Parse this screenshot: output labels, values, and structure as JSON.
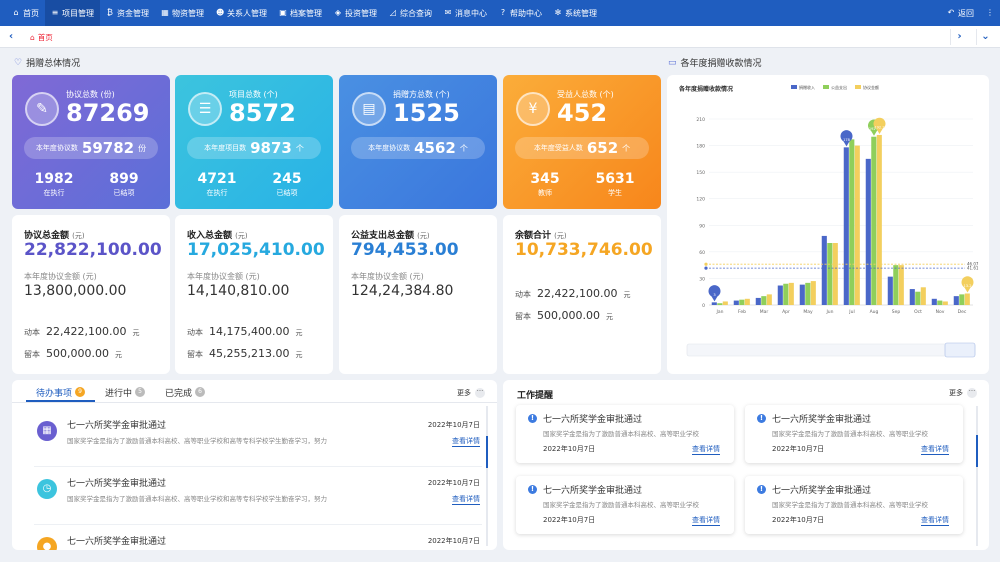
{
  "nav": {
    "items": [
      {
        "label": "首页",
        "icon": "home-icon",
        "glyph": "⌂"
      },
      {
        "label": "项目管理",
        "icon": "list-icon",
        "glyph": "≡",
        "active": true
      },
      {
        "label": "资金管理",
        "icon": "money-icon",
        "glyph": "₿"
      },
      {
        "label": "物资管理",
        "icon": "box-icon",
        "glyph": "▦"
      },
      {
        "label": "关系人管理",
        "icon": "people-icon",
        "glyph": "☻"
      },
      {
        "label": "档案管理",
        "icon": "folder-icon",
        "glyph": "▣"
      },
      {
        "label": "投资管理",
        "icon": "tag-icon",
        "glyph": "◈"
      },
      {
        "label": "综合查询",
        "icon": "chart-icon",
        "glyph": "◿"
      },
      {
        "label": "消息中心",
        "icon": "mail-icon",
        "glyph": "✉"
      },
      {
        "label": "帮助中心",
        "icon": "help-icon",
        "glyph": "?"
      },
      {
        "label": "系统管理",
        "icon": "gear-icon",
        "glyph": "✻"
      }
    ],
    "back_label": "返回"
  },
  "tabbar": {
    "home_tab": "首页"
  },
  "sections": {
    "donation_overview": "捐赠总体情况",
    "yearly_chart": "各年度捐赠收款情况"
  },
  "kpis": [
    {
      "label": "协议总数 (份)",
      "value": "87269",
      "pill_label": "本年度协议数",
      "pill_value": "59782",
      "pill_unit": "份",
      "sub1_value": "1982",
      "sub1_label": "在执行",
      "sub2_value": "899",
      "sub2_label": "已结项",
      "icon": "contract-icon",
      "glyph": "✎",
      "gradient": [
        "#8069d6",
        "#5b6fd8"
      ]
    },
    {
      "label": "项目总数 (个)",
      "value": "8572",
      "pill_label": "本年度项目数",
      "pill_value": "9873",
      "pill_unit": "个",
      "sub1_value": "4721",
      "sub1_label": "在执行",
      "sub2_value": "245",
      "sub2_label": "已结项",
      "icon": "clipboard-icon",
      "glyph": "☰",
      "gradient": [
        "#3cc4de",
        "#28b2e6"
      ]
    },
    {
      "label": "捐赠方总数 (个)",
      "value": "1525",
      "pill_label": "本年度协议数",
      "pill_value": "4562",
      "pill_unit": "个",
      "sub1_value": "",
      "sub1_label": "",
      "sub2_value": "",
      "sub2_label": "",
      "icon": "contact-card-icon",
      "glyph": "▤",
      "gradient": [
        "#4a90e2",
        "#3a76dd"
      ]
    },
    {
      "label": "受益人总数 (个)",
      "value": "452",
      "pill_label": "本年度受益人数",
      "pill_value": "652",
      "pill_unit": "个",
      "sub1_value": "345",
      "sub1_label": "教师",
      "sub2_value": "5631",
      "sub2_label": "学生",
      "icon": "beneficiary-icon",
      "glyph": "¥",
      "gradient": [
        "#fbad3a",
        "#f7861b"
      ]
    }
  ],
  "amounts": [
    {
      "label": "协议总金额",
      "unit": "(元)",
      "value": "22,822,100.00",
      "color": "#5b54c8",
      "sub_label": "本年度协议金额 (元)",
      "sub_value": "13,800,000.00",
      "row1_label": "动本",
      "row1_value": "22,422,100.00",
      "row1_unit": "元",
      "row2_label": "留本",
      "row2_value": "500,000.00",
      "row2_unit": "元"
    },
    {
      "label": "收入总金额",
      "unit": "(元)",
      "value": "17,025,410.00",
      "color": "#26a9df",
      "sub_label": "本年度协议金额 (元)",
      "sub_value": "14,140,810.00",
      "row1_label": "动本",
      "row1_value": "14,175,400.00",
      "row1_unit": "元",
      "row2_label": "留本",
      "row2_value": "45,255,213.00",
      "row2_unit": "元"
    },
    {
      "label": "公益支出总金额",
      "unit": "(元)",
      "value": "794,453.00",
      "color": "#2a7fd4",
      "sub_label": "本年度协议金额 (元)",
      "sub_value": "124,24,384.80",
      "row1_label": "",
      "row1_value": "",
      "row1_unit": "",
      "row2_label": "",
      "row2_value": "",
      "row2_unit": ""
    },
    {
      "label": "余额合计",
      "unit": "(元)",
      "value": "10,733,746.00",
      "color": "#f5a623",
      "sub_label": "",
      "sub_value": "",
      "row1_label": "动本",
      "row1_value": "22,422,100.00",
      "row1_unit": "元",
      "row2_label": "留本",
      "row2_value": "500,000.00",
      "row2_unit": "元"
    }
  ],
  "chart_data": {
    "type": "bar",
    "title": "各年度捐赠收款情况",
    "categories": [
      "Jan",
      "Feb",
      "Mar",
      "Apr",
      "May",
      "Jun",
      "Jul",
      "Aug",
      "Sep",
      "Oct",
      "Nov",
      "Dec"
    ],
    "series": [
      {
        "name": "捐赠收入",
        "color": "#4a67c8",
        "values": [
          3,
          5,
          8,
          22,
          23,
          78,
          178,
          165,
          32,
          18,
          7,
          10
        ]
      },
      {
        "name": "公益支出",
        "color": "#8fcf5b",
        "values": [
          2,
          6,
          10,
          24,
          25,
          70,
          187,
          190,
          45,
          15,
          5,
          12
        ]
      },
      {
        "name": "协议金额",
        "color": "#f3cf5e",
        "values": [
          4,
          7,
          12,
          25,
          27,
          70,
          180,
          192,
          45,
          20,
          4,
          13
        ]
      }
    ],
    "ylim": [
      0,
      210
    ],
    "yticks": [
      0,
      30,
      60,
      90,
      120,
      150,
      180,
      210
    ],
    "ref_lines": [
      {
        "label": "46.07",
        "value": 46.07,
        "color": "#f3cf5e"
      },
      {
        "label": "41.61",
        "value": 41.61,
        "color": "#4a67c8"
      }
    ],
    "markers": [
      {
        "category": "Jan",
        "series": 0,
        "label": "3",
        "color": "#4a67c8"
      },
      {
        "category": "Jul",
        "series": 0,
        "label": "178",
        "color": "#4a67c8"
      },
      {
        "category": "Aug",
        "series": 1,
        "label": "192.2",
        "color": "#8fcf5b"
      },
      {
        "category": "Aug",
        "series": 2,
        "label": "192.2",
        "color": "#f3cf5e"
      },
      {
        "category": "Dec",
        "series": 2,
        "label": "13.2",
        "color": "#f3cf5e"
      }
    ],
    "grid": true,
    "legend": "top"
  },
  "todo": {
    "tabs": [
      {
        "label": "待办事项",
        "count": "9",
        "active": true
      },
      {
        "label": "进行中",
        "count": "5"
      },
      {
        "label": "已完成",
        "count": "6"
      }
    ],
    "more_label": "更多",
    "items": [
      {
        "title": "七一六所奖学金审批通过",
        "desc": "国家奖学金是指为了激励普通本科高校、高等职业学校和高等专科学校学生勤奋学习，努力",
        "date": "2022年10月7日",
        "link": "查看详情",
        "icon": "calendar-icon",
        "glyph": "▦",
        "color": "#6a5fd0"
      },
      {
        "title": "七一六所奖学金审批通过",
        "desc": "国家奖学金是指为了激励普通本科高校、高等职业学校和高等专科学校学生勤奋学习，努力",
        "date": "2022年10月7日",
        "link": "查看详情",
        "icon": "clock-icon",
        "glyph": "◷",
        "color": "#3cc4de"
      },
      {
        "title": "七一六所奖学金审批通过",
        "desc": "",
        "date": "2022年10月7日",
        "link": "",
        "icon": "coin-icon",
        "glyph": "●",
        "color": "#f5a623"
      }
    ]
  },
  "reminders": {
    "title": "工作提醒",
    "more_label": "更多",
    "items": [
      {
        "title": "七一六所奖学金审批通过",
        "desc": "国家奖学金是指为了激励普通本科高校、高等职业学校",
        "date": "2022年10月7日",
        "link": "查看详情"
      },
      {
        "title": "七一六所奖学金审批通过",
        "desc": "国家奖学金是指为了激励普通本科高校、高等职业学校",
        "date": "2022年10月7日",
        "link": "查看详情"
      },
      {
        "title": "七一六所奖学金审批通过",
        "desc": "国家奖学金是指为了激励普通本科高校、高等职业学校",
        "date": "2022年10月7日",
        "link": "查看详情"
      },
      {
        "title": "七一六所奖学金审批通过",
        "desc": "国家奖学金是指为了激励普通本科高校、高等职业学校",
        "date": "2022年10月7日",
        "link": "查看详情"
      }
    ]
  }
}
